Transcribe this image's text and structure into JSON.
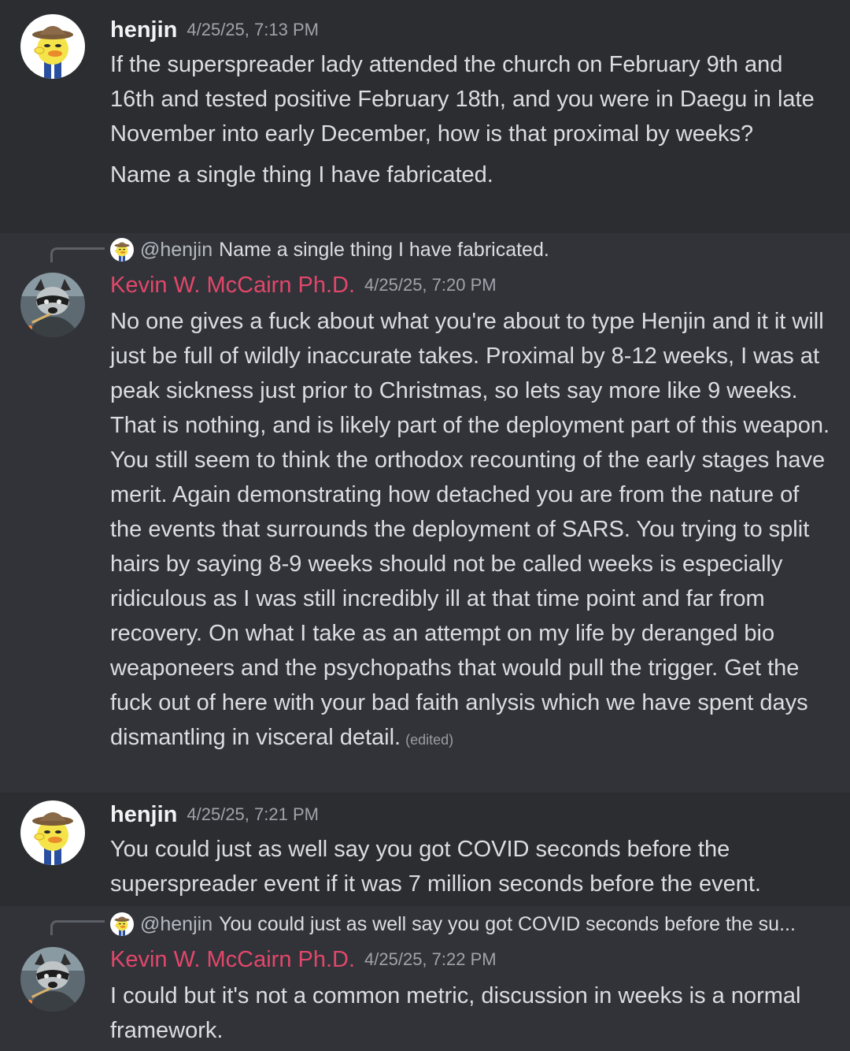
{
  "messages": [
    {
      "author": "henjin",
      "timestamp": "4/25/25, 7:13 PM",
      "avatar": "henjin-avatar",
      "paragraphs": [
        "If the superspreader lady attended the church on February 9th and 16th and tested positive February 18th, and you were in Daegu in late November into early December, how is that proximal by weeks?",
        "Name a single thing I have fabricated."
      ]
    },
    {
      "author": "Kevin W. McCairn Ph.D.",
      "timestamp": "4/25/25, 7:20 PM",
      "avatar": "raccoon-avatar",
      "reply_to": {
        "mention": "@henjin",
        "text": "Name a single thing I have fabricated."
      },
      "text": "No one gives a fuck about what you're about to type Henjin and it it will just be full of wildly inaccurate takes. Proximal by 8-12 weeks, I was at peak sickness just prior to Christmas, so lets say more like 9 weeks. That is nothing, and is likely part of the deployment part of this weapon. You still seem to think the orthodox recounting of the early stages have merit. Again demonstrating how detached you are from the nature of the events that surrounds the deployment of SARS. You trying to split hairs by saying 8-9 weeks should not be called weeks is especially ridiculous as I was still incredibly ill at that time point and far from recovery.  On what I take as an attempt on my life by deranged bio weaponeers and the psychopaths that would pull the trigger. Get the fuck out of here with your bad faith anlysis which we have spent days dismantling in visceral detail.",
      "edited_label": "(edited)"
    },
    {
      "author": "henjin",
      "timestamp": "4/25/25, 7:21 PM",
      "avatar": "henjin-avatar",
      "text": "You could just as well say you got COVID seconds before the superspreader event if it was 7 million seconds before the event."
    },
    {
      "author": "Kevin W. McCairn Ph.D.",
      "timestamp": "4/25/25, 7:22 PM",
      "avatar": "raccoon-avatar",
      "reply_to": {
        "mention": "@henjin",
        "text": "You could just as well say you got COVID seconds before the su..."
      },
      "text": "I could but it's not a common metric, discussion in weeks is a normal framework."
    }
  ],
  "colors": {
    "background": "#313338",
    "highlight_background": "#2b2d31",
    "henjin_name": "#f2f3f5",
    "kevin_name": "#e2476b",
    "timestamp": "#a0a3a9"
  }
}
